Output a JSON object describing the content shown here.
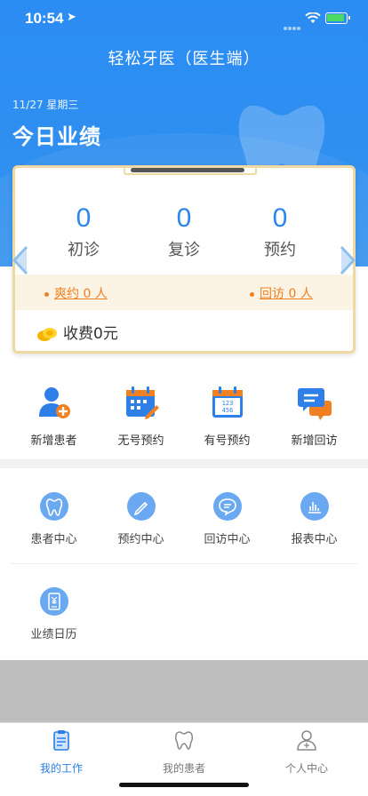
{
  "status": {
    "time": "10:54"
  },
  "nav": {
    "title": "轻松牙医（医生端）"
  },
  "header": {
    "date": "11/27 星期三",
    "title": "今日业绩"
  },
  "stats": [
    {
      "value": "0",
      "label": "初诊"
    },
    {
      "value": "0",
      "label": "复诊"
    },
    {
      "value": "0",
      "label": "预约"
    }
  ],
  "band": {
    "left": "爽约 0 人",
    "right": "回访 0 人"
  },
  "fee": "收费0元",
  "quick_actions": [
    {
      "label": "新增患者"
    },
    {
      "label": "无号预约"
    },
    {
      "label": "有号预约"
    },
    {
      "label": "新增回访"
    }
  ],
  "grid": [
    {
      "label": "患者中心"
    },
    {
      "label": "预约中心"
    },
    {
      "label": "回访中心"
    },
    {
      "label": "报表中心"
    },
    {
      "label": "业绩日历"
    }
  ],
  "tabbar": [
    {
      "label": "我的工作",
      "active": true
    },
    {
      "label": "我的患者",
      "active": false
    },
    {
      "label": "个人中心",
      "active": false
    }
  ],
  "colors": {
    "primary": "#2b8cf3",
    "accent": "#f08020",
    "card_border": "#f0d9a0",
    "icon_blue": "#6aa8f2"
  }
}
